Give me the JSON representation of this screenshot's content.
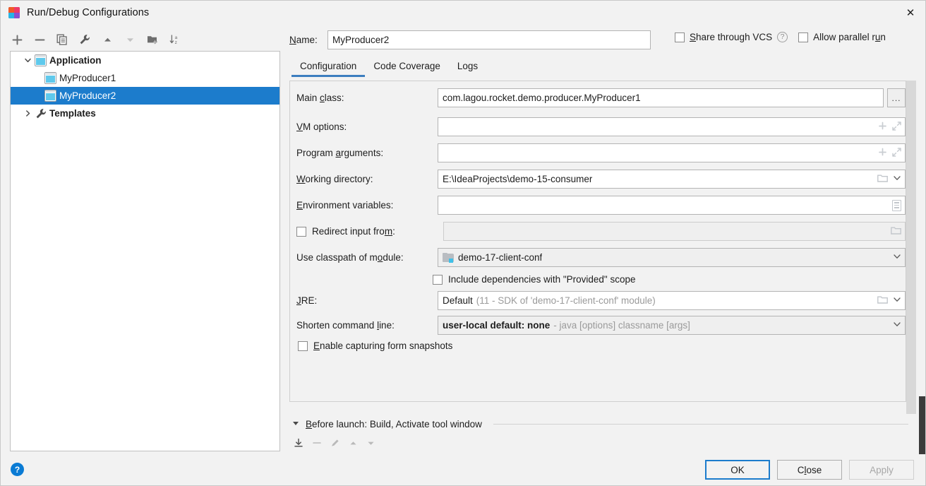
{
  "window": {
    "title": "Run/Debug Configurations",
    "app_icon": "intellij-idea-icon",
    "close_icon": "close-icon"
  },
  "toolbar": {
    "items": [
      {
        "name": "add-configuration-button",
        "icon": "plus-icon",
        "label": "+"
      },
      {
        "name": "remove-configuration-button",
        "icon": "minus-icon",
        "label": "−"
      },
      {
        "name": "copy-configuration-button",
        "icon": "copy-icon",
        "label": "Copy"
      },
      {
        "name": "edit-templates-button",
        "icon": "wrench-icon",
        "label": "Edit Templates"
      },
      {
        "name": "move-up-button",
        "icon": "arrow-up-icon",
        "label": "Move Up"
      },
      {
        "name": "move-down-button",
        "icon": "arrow-down-icon",
        "label": "Move Down"
      },
      {
        "name": "new-folder-button",
        "icon": "folder-add-icon",
        "label": "New Folder"
      },
      {
        "name": "sort-configurations-button",
        "icon": "sort-az-icon",
        "label": "Sort Configurations"
      }
    ]
  },
  "tree": {
    "nodes": [
      {
        "label": "Application",
        "icon": "application-icon",
        "expanded": true,
        "bold": true,
        "level": 0,
        "selected": false
      },
      {
        "label": "MyProducer1",
        "icon": "run-configuration-icon",
        "level": 1,
        "selected": false
      },
      {
        "label": "MyProducer2",
        "icon": "run-configuration-icon",
        "level": 1,
        "selected": true
      },
      {
        "label": "Templates",
        "icon": "wrench-icon",
        "expanded": false,
        "bold": true,
        "level": 0,
        "selected": false
      }
    ]
  },
  "header": {
    "name_label": "Name:",
    "name_mnemonic": "N",
    "name_value": "MyProducer2",
    "share_vcs_label": "Share through VCS",
    "share_vcs_mnemonic": "S",
    "share_vcs_checked": false,
    "help_icon": "question-mark-icon",
    "allow_parallel_label": "Allow parallel run",
    "allow_parallel_mnemonic": "u",
    "allow_parallel_checked": false
  },
  "tabs": [
    {
      "label": "Configuration",
      "active": true
    },
    {
      "label": "Code Coverage",
      "active": false
    },
    {
      "label": "Logs",
      "active": false
    }
  ],
  "fields": {
    "main_class": {
      "label": "Main class:",
      "mnemonic": "c",
      "value": "com.lagou.rocket.demo.producer.MyProducer1",
      "browse_label": "..."
    },
    "vm_options": {
      "label": "VM options:",
      "mnemonic": "V",
      "value": "",
      "icons": [
        "plus-icon",
        "expand-icon"
      ]
    },
    "program_arguments": {
      "label": "Program arguments:",
      "mnemonic": "a",
      "value": "",
      "icons": [
        "plus-icon",
        "expand-icon"
      ]
    },
    "working_directory": {
      "label": "Working directory:",
      "mnemonic": "W",
      "value": "E:\\IdeaProjects\\demo-15-consumer",
      "icons": [
        "folder-icon",
        "chevron-down-icon"
      ]
    },
    "environment_variables": {
      "label": "Environment variables:",
      "mnemonic": "E",
      "value": "",
      "icons": [
        "list-edit-icon"
      ]
    },
    "redirect_input": {
      "label": "Redirect input from:",
      "mnemonic": "d",
      "checked": false,
      "value": "",
      "disabled": true,
      "icons": [
        "folder-icon"
      ]
    },
    "classpath_module": {
      "label": "Use classpath of module:",
      "mnemonic": "o",
      "value": "demo-17-client-conf",
      "value_icon": "module-icon",
      "icons": [
        "chevron-down-icon"
      ]
    },
    "include_provided": {
      "label": "Include dependencies with \"Provided\" scope",
      "checked": false
    },
    "jre": {
      "label": "JRE:",
      "mnemonic": "J",
      "value": "Default",
      "hint": "(11 - SDK of 'demo-17-client-conf' module)",
      "icons": [
        "folder-icon",
        "chevron-down-icon"
      ]
    },
    "shorten_command_line": {
      "label": "Shorten command line:",
      "mnemonic": "l",
      "value": "user-local default: none",
      "hint": "- java [options] classname [args]",
      "icons": [
        "chevron-down-icon"
      ]
    },
    "form_snapshots": {
      "label": "Enable capturing form snapshots",
      "mnemonic": "E",
      "checked": false
    }
  },
  "before_launch": {
    "caret_icon": "triangle-down-icon",
    "title": "Before launch: Build, Activate tool window",
    "mnemonic": "B",
    "toolbar": [
      {
        "name": "add-task-button",
        "icon": "add-task-icon",
        "enabled": true
      },
      {
        "name": "remove-task-button",
        "icon": "minus-icon",
        "enabled": false
      },
      {
        "name": "edit-task-button",
        "icon": "pencil-icon",
        "enabled": false
      },
      {
        "name": "task-move-up-button",
        "icon": "arrow-up-icon",
        "enabled": false
      },
      {
        "name": "task-move-down-button",
        "icon": "arrow-down-icon",
        "enabled": false
      }
    ]
  },
  "footer": {
    "help_icon": "question-mark-icon",
    "ok_label": "OK",
    "close_label": "Close",
    "close_mnemonic": "l",
    "apply_label": "Apply",
    "apply_enabled": false
  },
  "colors": {
    "selection_blue": "#1c7ccc",
    "tab_underline": "#3c7ebf",
    "help_blue": "#0a7bd4",
    "dialog_bg": "#f2f2f2",
    "field_bg": "#ffffff",
    "disabled_text": "#a8a8a8"
  }
}
